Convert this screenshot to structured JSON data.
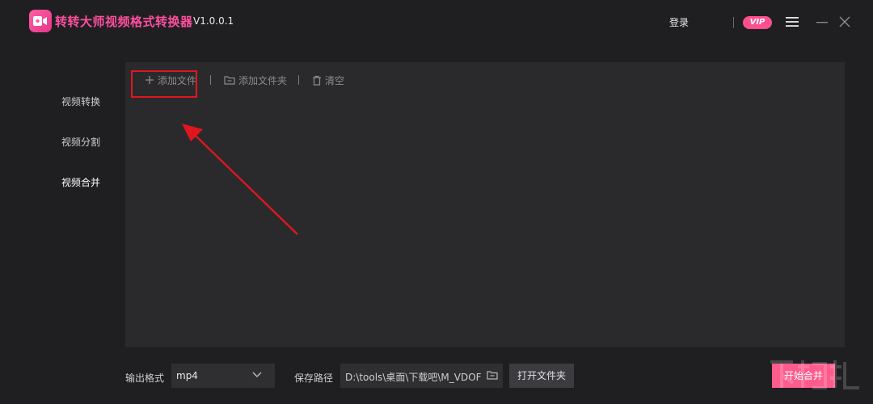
{
  "app": {
    "title": "转转大师视频格式转换器",
    "version": "V1.0.0.1",
    "login_label": "登录",
    "vip_label": "VIP"
  },
  "sidebar": {
    "items": [
      {
        "label": "视频转换"
      },
      {
        "label": "视频分割"
      },
      {
        "label": "视频合并"
      }
    ],
    "active_index": 2
  },
  "toolbar": {
    "add_file_label": "添加文件",
    "add_folder_label": "添加文件夹",
    "clear_label": "清空"
  },
  "bottom": {
    "format_label": "输出格式",
    "format_value": "mp4",
    "save_path_label": "保存路径",
    "save_path_value": "D:\\tools\\桌面\\下载吧\\M_VDOF",
    "open_folder_label": "打开文件夹",
    "start_label": "开始合并"
  },
  "colors": {
    "accent": "#ff4f8e",
    "annotation": "#e0161f",
    "background": "#1f1f21",
    "panel": "#2a2a2d"
  }
}
